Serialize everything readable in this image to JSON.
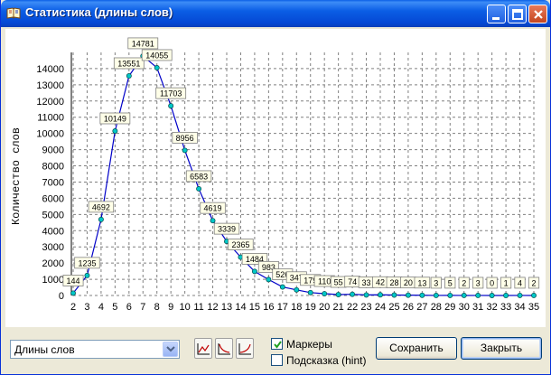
{
  "window": {
    "title": "Статистика (длины слов)"
  },
  "controls": {
    "combo_value": "Длины слов",
    "markers_label": "Маркеры",
    "markers_checked": true,
    "hint_label": "Подсказка (hint)",
    "hint_checked": false,
    "save_label": "Сохранить",
    "close_label": "Закрыть"
  },
  "colors": {
    "line": "#0000c8",
    "marker_fill": "#00c8c8",
    "grid": "#808080",
    "label_bg": "#ffffe8"
  },
  "chart_data": {
    "type": "line",
    "ylabel": "Количество слов",
    "xlabel": "",
    "title": "",
    "ylim": [
      0,
      15000
    ],
    "yticks": [
      0,
      1000,
      2000,
      3000,
      4000,
      5000,
      6000,
      7000,
      8000,
      9000,
      10000,
      11000,
      12000,
      13000,
      14000
    ],
    "grid": true,
    "x": [
      2,
      3,
      4,
      5,
      6,
      7,
      8,
      9,
      10,
      11,
      12,
      13,
      14,
      15,
      16,
      17,
      18,
      19,
      20,
      21,
      22,
      23,
      24,
      25,
      26,
      27,
      28,
      29,
      30,
      31,
      32,
      33,
      34,
      35
    ],
    "series": [
      {
        "values": [
          144,
          1235,
          4692,
          10149,
          13551,
          14781,
          14055,
          11703,
          8956,
          6583,
          4619,
          3339,
          2365,
          1484,
          983,
          526,
          347,
          179,
          110,
          55,
          74,
          33,
          42,
          28,
          20,
          13,
          3,
          5,
          2,
          3,
          0,
          1,
          4,
          2
        ]
      }
    ]
  }
}
